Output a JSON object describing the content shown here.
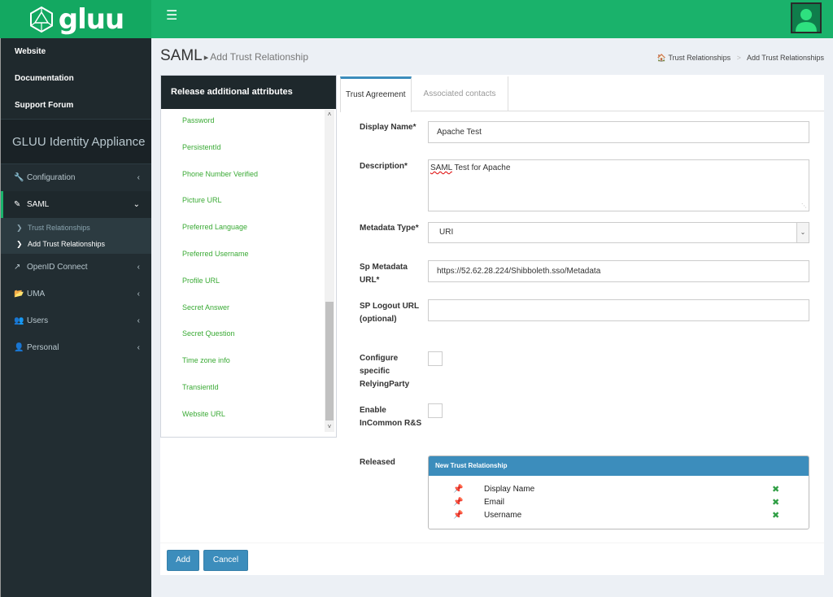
{
  "header": {
    "logo_text": "gluu",
    "menu_icon": "hamburger-icon",
    "avatar_icon": "user-avatar-icon"
  },
  "sidebar": {
    "links": [
      "Website",
      "Documentation",
      "Support Forum"
    ],
    "appliance_title": "GLUU Identity Appliance",
    "menu": [
      {
        "label": "Configuration",
        "icon": "wrench-icon"
      },
      {
        "label": "SAML",
        "icon": "edit-icon"
      },
      {
        "label": "OpenID Connect",
        "icon": "external-link-icon"
      },
      {
        "label": "UMA",
        "icon": "folder-open-icon"
      },
      {
        "label": "Users",
        "icon": "users-icon"
      },
      {
        "label": "Personal",
        "icon": "user-icon"
      }
    ],
    "saml_submenu": [
      "Trust Relationships",
      "Add Trust Relationships"
    ]
  },
  "page": {
    "title": "SAML",
    "subtitle": "Add Trust Relationship",
    "breadcrumb": [
      "Trust Relationships",
      "Add Trust Relationships"
    ]
  },
  "attributes": {
    "header": "Release additional attributes",
    "items": [
      "Password",
      "PersistentId",
      "Phone Number Verified",
      "Picture URL",
      "Preferred Language",
      "Preferred Username",
      "Profile URL",
      "Secret Answer",
      "Secret Question",
      "Time zone info",
      "TransientId",
      "Website URL"
    ]
  },
  "tabs": [
    "Trust Agreement",
    "Associated contacts"
  ],
  "form": {
    "display_name_label": "Display Name*",
    "display_name_value": "Apache Test",
    "description_label": "Description*",
    "description_value_underlined": "SAML",
    "description_value_rest": " Test for Apache",
    "metadata_type_label": "Metadata Type*",
    "metadata_type_value": "URI",
    "sp_metadata_url_label": "Sp Metadata URL*",
    "sp_metadata_url_value": "https://52.62.28.224/Shibboleth.sso/Metadata",
    "sp_logout_url_label": "SP Logout URL (optional)",
    "sp_logout_url_value": "",
    "configure_rp_label": "Configure specific RelyingParty",
    "incommon_label": "Enable InCommon R&S",
    "released_label": "Released"
  },
  "released": {
    "header": "New Trust Relationship",
    "items": [
      "Display Name",
      "Email",
      "Username"
    ]
  },
  "buttons": {
    "add": "Add",
    "cancel": "Cancel"
  },
  "colors": {
    "brand_green": "#1ab26b",
    "sidebar_dark": "#222d32",
    "primary_blue": "#3c8dbc",
    "attr_green": "#3aaa35"
  }
}
